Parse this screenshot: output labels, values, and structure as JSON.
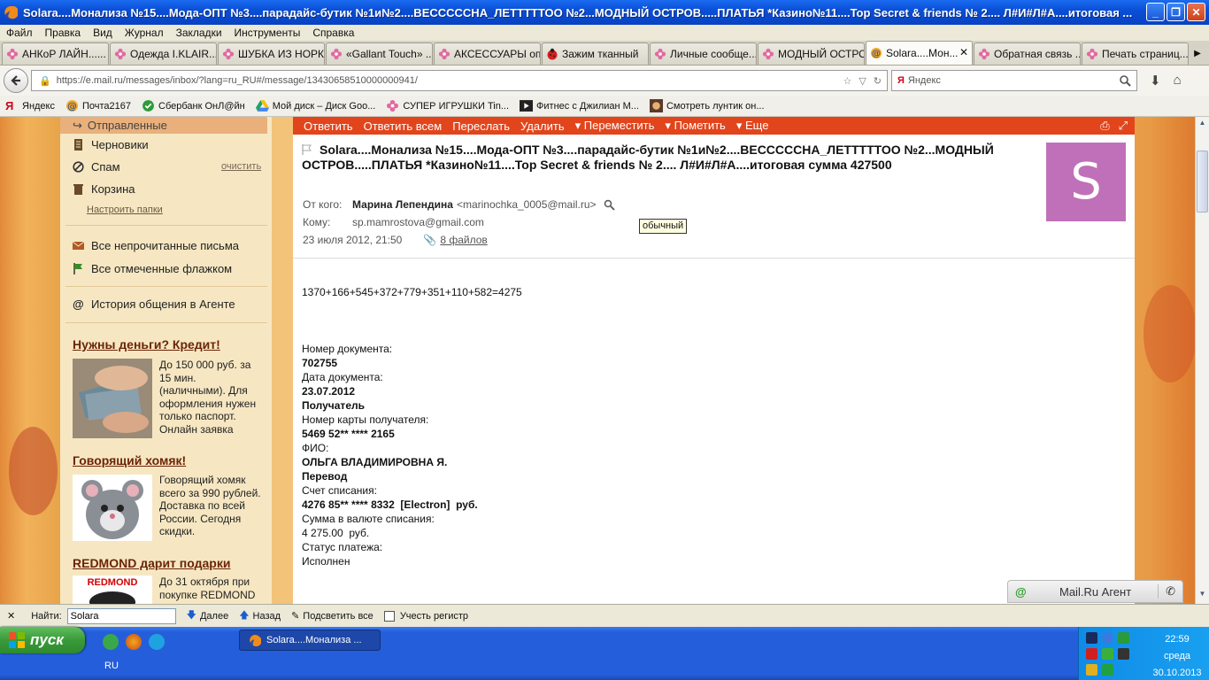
{
  "window": {
    "title": "Solara....Монализа №15....Мода-ОПТ №3....парадайс-бутик №1и№2....ВЕСССССНА_ЛЕТТТТТОО №2...МОДНЫЙ ОСТРОВ.....ПЛАТЬЯ *Казино№11....Top Secret & friends № 2.... Л#И#Л#А....итоговая ..."
  },
  "menu": [
    "Файл",
    "Правка",
    "Вид",
    "Журнал",
    "Закладки",
    "Инструменты",
    "Справка"
  ],
  "tabs": [
    {
      "label": "АНКоР ЛАЙН......",
      "icon": "flower-icon"
    },
    {
      "label": "Одежда I.KLAIR...",
      "icon": "flower-icon"
    },
    {
      "label": "ШУБКА ИЗ НОРК...",
      "icon": "flower-icon"
    },
    {
      "label": "«Gallant Touch» ...",
      "icon": "flower-icon"
    },
    {
      "label": "АКСЕССУАРЫ оп...",
      "icon": "flower-icon"
    },
    {
      "label": "Зажим тканный",
      "icon": "ladybug-icon"
    },
    {
      "label": "Личные сообще...",
      "icon": "flower-icon"
    },
    {
      "label": "МОДНЫЙ ОСТРО...",
      "icon": "flower-icon"
    },
    {
      "label": "Solara....Мон...",
      "icon": "mail-icon",
      "active": true
    },
    {
      "label": "Обратная связь ...",
      "icon": "flower-icon"
    },
    {
      "label": "Печать страниц...",
      "icon": "flower-icon"
    }
  ],
  "nav": {
    "url": "https://e.mail.ru/messages/inbox/?lang=ru_RU#/message/13430658510000000941/",
    "search_placeholder": "Яндекс"
  },
  "bookmarks": [
    {
      "label": "Яндекс",
      "icon": "yandex-icon"
    },
    {
      "label": "Почта2167",
      "icon": "mail-icon"
    },
    {
      "label": "Сбербанк ОнЛ@йн",
      "icon": "sberbank-icon"
    },
    {
      "label": "Мой диск – Диск Goo...",
      "icon": "drive-icon"
    },
    {
      "label": "СУПЕР ИГРУШКИ Tin...",
      "icon": "flower-icon"
    },
    {
      "label": "Фитнес с Джилиан М...",
      "icon": "play-icon"
    },
    {
      "label": "Смотреть лунтик он...",
      "icon": "film-icon"
    }
  ],
  "sidebar": {
    "sent": "Отправленные",
    "drafts": "Черновики",
    "spam": "Спам",
    "spam_clean": "очистить",
    "trash": "Корзина",
    "setup_folders": "Настроить папки",
    "all_unread": "Все непрочитанные письма",
    "all_flagged": "Все отмеченные флажком",
    "agent_history": "История общения в Агенте"
  },
  "ads": [
    {
      "title": "Нужны деньги? Кредит!",
      "text": "До 150 000 руб. за 15 мин. (наличными). Для оформления нужен только паспорт. Онлайн заявка"
    },
    {
      "title": "Говорящий хомяк!",
      "text": "Говорящий хомяк всего за 990 рублей. Доставка по всей России. Сегодня скидки."
    },
    {
      "title": "REDMOND дарит подарки",
      "text": "До 31 октября при покупке REDMOND",
      "logo": "REDMOND"
    }
  ],
  "toolbar": [
    "Ответить",
    "Ответить всем",
    "Переслать",
    "Удалить",
    "Переместить",
    "Пометить",
    "Еще"
  ],
  "message": {
    "subject": "Solara....Монализа №15....Мода-ОПТ №3....парадайс-бутик №1и№2....ВЕСССССНА_ЛЕТТТТТОО №2...МОДНЫЙ ОСТРОВ.....ПЛАТЬЯ *Казино№11....Top Secret & friends № 2.... Л#И#Л#А....итоговая сумма 427500",
    "from_label": "От кого:",
    "from_name": "Марина Лепендина",
    "from_addr": "<marinochka_0005@mail.ru>",
    "tooltip": "обычный",
    "to_label": "Кому:",
    "to_addr": "sp.mamrostova@gmail.com",
    "date": "23 июля 2012, 21:50",
    "attachments": "8 файлов",
    "avatar_letter": "S"
  },
  "body": {
    "sum_line": "1370+166+545+372+779+351+110+582=4275",
    "doc_num_label": "Номер документа:",
    "doc_num": "702755",
    "doc_date_label": "Дата документа:",
    "doc_date": "23.07.2012",
    "recipient": "Получатель",
    "card_label": "Номер карты получателя:",
    "card": "5469 52** **** 2165",
    "fio_label": "ФИО:",
    "fio": "ОЛЬГА ВЛАДИМИРОВНА Я.",
    "transfer": "Перевод",
    "account_label": "Счет списания:",
    "account": "4276 85** **** 8332  [Electron]  руб.",
    "amount_label": "Сумма в валюте списания:",
    "amount": "4 275.00  руб.",
    "status_label": "Статус платежа:",
    "status": "Исполнен"
  },
  "agent": {
    "label": "Mail.Ru Агент"
  },
  "findbar": {
    "label": "Найти:",
    "value": "Solara",
    "next": "Далее",
    "prev": "Назад",
    "highlight": "Подсветить все",
    "match_case": "Учесть регистр"
  },
  "taskbar": {
    "start": "пуск",
    "window_item": "Solara....Монализа ...",
    "lang": "RU",
    "time": "22:59",
    "weekday": "среда",
    "date": "30.10.2013"
  },
  "colors": {
    "mailru_orange": "#e2451c",
    "avatar": "#c070b8",
    "xp_blue": "#245edb",
    "start_green": "#3a9a3a",
    "sidebar_bg": "#f6e7c2"
  }
}
